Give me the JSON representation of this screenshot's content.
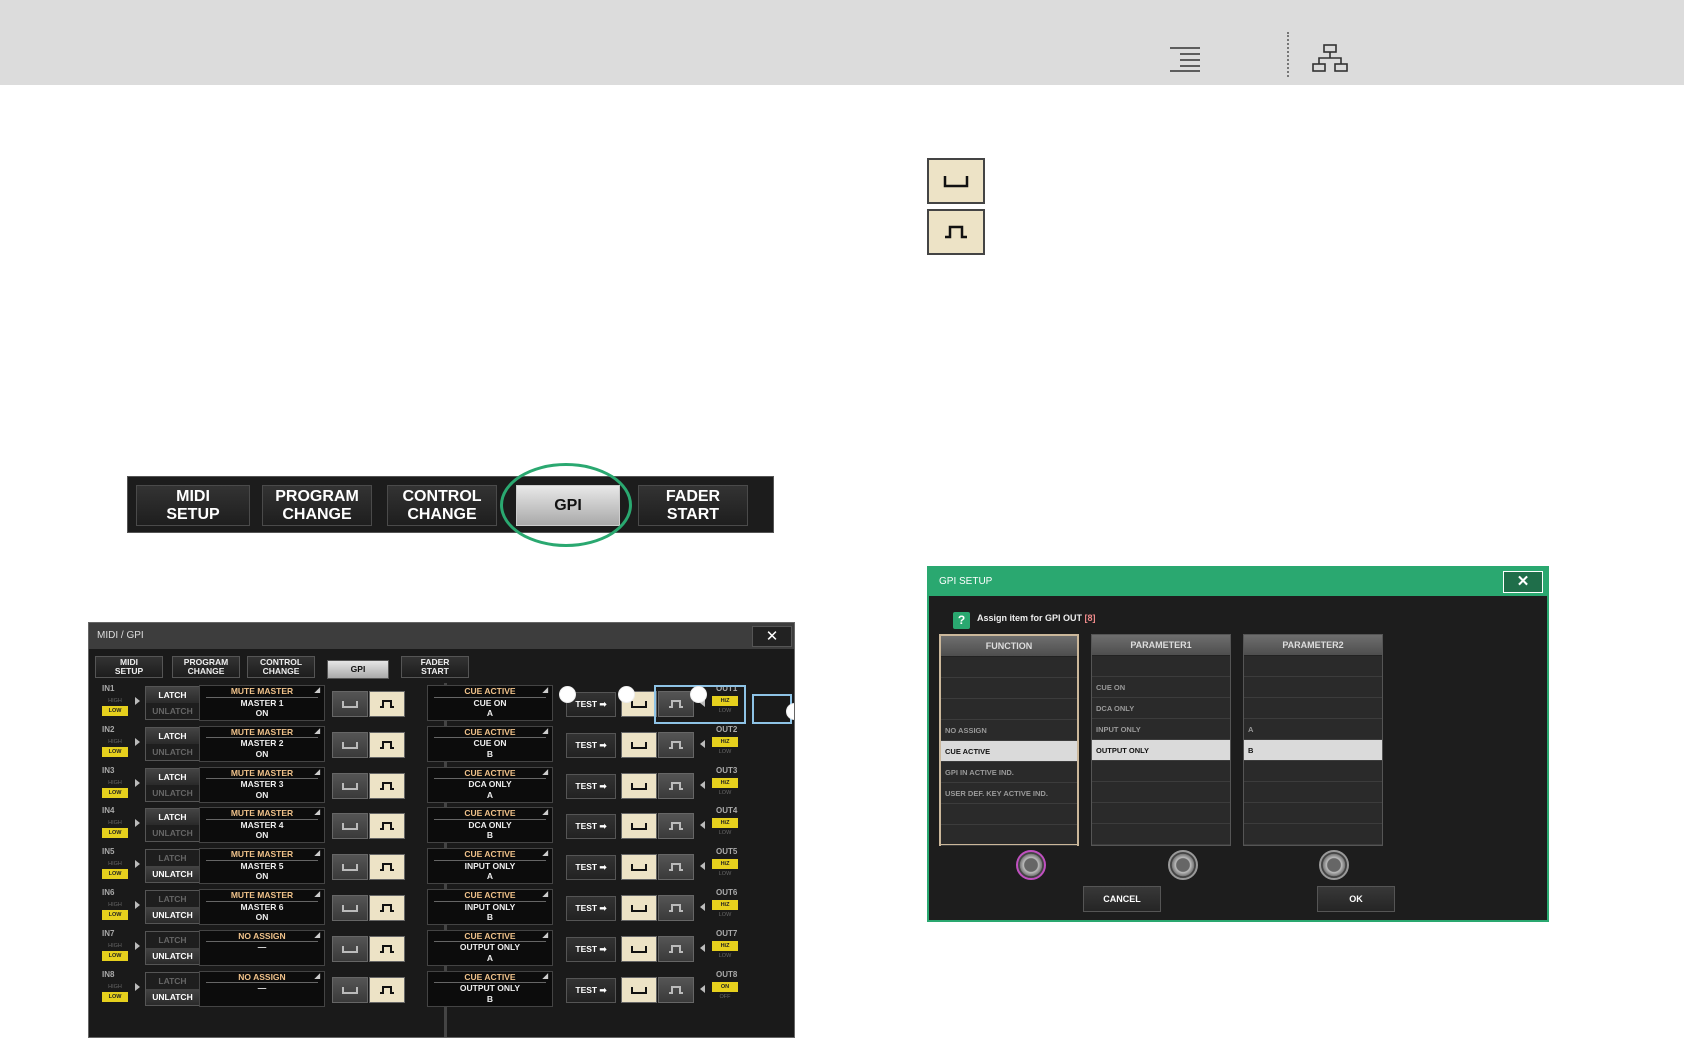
{
  "polarity_icons": [
    "active-low-icon",
    "active-high-icon"
  ],
  "tab_strip": {
    "tabs": [
      "MIDI\nSETUP",
      "PROGRAM\nCHANGE",
      "CONTROL\nCHANGE",
      "GPI",
      "FADER\nSTART"
    ],
    "active_tab": "GPI",
    "highlight_color": "#2aa870"
  },
  "midi_gpi": {
    "title": "MIDI / GPI",
    "close": "✕",
    "tabs": [
      "MIDI\nSETUP",
      "PROGRAM\nCHANGE",
      "CONTROL\nCHANGE",
      "GPI",
      "FADER\nSTART"
    ],
    "active_tab": "GPI",
    "high_label": "HIGH",
    "low_label": "LOW",
    "latch_label": "LATCH",
    "unlatch_label": "UNLATCH",
    "test_label": "TEST ➡",
    "inputs": [
      {
        "label": "IN1",
        "mode": "LATCH",
        "title": "MUTE MASTER",
        "line2": "MASTER 1",
        "line3": "ON"
      },
      {
        "label": "IN2",
        "mode": "LATCH",
        "title": "MUTE MASTER",
        "line2": "MASTER 2",
        "line3": "ON"
      },
      {
        "label": "IN3",
        "mode": "LATCH",
        "title": "MUTE MASTER",
        "line2": "MASTER 3",
        "line3": "ON"
      },
      {
        "label": "IN4",
        "mode": "LATCH",
        "title": "MUTE MASTER",
        "line2": "MASTER 4",
        "line3": "ON"
      },
      {
        "label": "IN5",
        "mode": "UNLATCH",
        "title": "MUTE MASTER",
        "line2": "MASTER 5",
        "line3": "ON"
      },
      {
        "label": "IN6",
        "mode": "UNLATCH",
        "title": "MUTE MASTER",
        "line2": "MASTER 6",
        "line3": "ON"
      },
      {
        "label": "IN7",
        "mode": "UNLATCH",
        "title": "NO ASSIGN",
        "line2": "—",
        "line3": ""
      },
      {
        "label": "IN8",
        "mode": "UNLATCH",
        "title": "NO ASSIGN",
        "line2": "—",
        "line3": ""
      }
    ],
    "outputs": [
      {
        "label": "OUT1",
        "title": "CUE ACTIVE",
        "line2": "CUE ON",
        "line3": "A",
        "state": [
          "HiZ",
          "LOW"
        ],
        "selected": "HiZ"
      },
      {
        "label": "OUT2",
        "title": "CUE ACTIVE",
        "line2": "CUE ON",
        "line3": "B",
        "state": [
          "HiZ",
          "LOW"
        ],
        "selected": "HiZ"
      },
      {
        "label": "OUT3",
        "title": "CUE ACTIVE",
        "line2": "DCA ONLY",
        "line3": "A",
        "state": [
          "HiZ",
          "LOW"
        ],
        "selected": "HiZ"
      },
      {
        "label": "OUT4",
        "title": "CUE ACTIVE",
        "line2": "DCA ONLY",
        "line3": "B",
        "state": [
          "HiZ",
          "LOW"
        ],
        "selected": "HiZ"
      },
      {
        "label": "OUT5",
        "title": "CUE ACTIVE",
        "line2": "INPUT ONLY",
        "line3": "A",
        "state": [
          "HiZ",
          "LOW"
        ],
        "selected": "HiZ"
      },
      {
        "label": "OUT6",
        "title": "CUE ACTIVE",
        "line2": "INPUT ONLY",
        "line3": "B",
        "state": [
          "HiZ",
          "LOW"
        ],
        "selected": "HiZ"
      },
      {
        "label": "OUT7",
        "title": "CUE ACTIVE",
        "line2": "OUTPUT ONLY",
        "line3": "A",
        "state": [
          "HiZ",
          "LOW"
        ],
        "selected": "HiZ"
      },
      {
        "label": "OUT8",
        "title": "CUE ACTIVE",
        "line2": "OUTPUT ONLY",
        "line3": "B",
        "state": [
          "ON",
          "OFF"
        ],
        "selected": "ON"
      }
    ]
  },
  "gpi_setup": {
    "title": "GPI SETUP",
    "close": "✕",
    "help": "?",
    "assign_text": "Assign item for GPI OUT ",
    "assign_num": "[8]",
    "function": {
      "header": "FUNCTION",
      "items": [
        "",
        "",
        "",
        "NO ASSIGN",
        "CUE ACTIVE",
        "GPI IN ACTIVE IND.",
        "USER DEF. KEY ACTIVE IND.",
        "",
        ""
      ],
      "selected": "CUE ACTIVE"
    },
    "parameter1": {
      "header": "PARAMETER1",
      "items": [
        "",
        "CUE ON",
        "DCA ONLY",
        "INPUT ONLY",
        "OUTPUT ONLY",
        "",
        "",
        "",
        ""
      ],
      "selected": "OUTPUT ONLY"
    },
    "parameter2": {
      "header": "PARAMETER2",
      "items": [
        "",
        "",
        "",
        "A",
        "B",
        "",
        "",
        "",
        ""
      ],
      "selected": "B"
    },
    "cancel": "CANCEL",
    "ok": "OK"
  },
  "colors": {
    "accent": "#2aa870",
    "active_button": "#ede3c6",
    "indicator": "#e6d01d"
  }
}
